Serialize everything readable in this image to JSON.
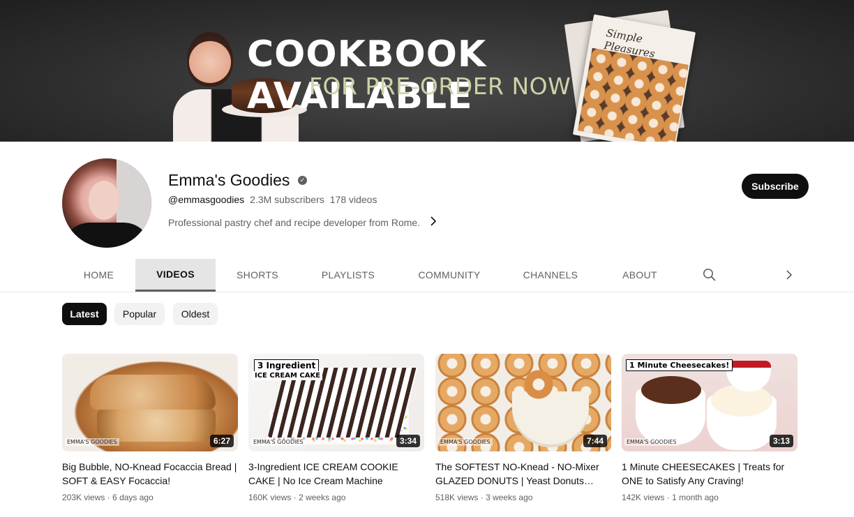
{
  "banner": {
    "title": "COOKBOOK AVAILABLE",
    "subtitle": "FOR PRE-ORDER NOW",
    "book_title": "Simple Pleasures"
  },
  "channel": {
    "name": "Emma's Goodies",
    "handle": "@emmasgoodies",
    "subscribers": "2.3M subscribers",
    "videos": "178 videos",
    "description": "Professional pastry chef and recipe developer from Rome.",
    "subscribe_label": "Subscribe"
  },
  "tabs": [
    {
      "label": "HOME"
    },
    {
      "label": "VIDEOS",
      "active": true
    },
    {
      "label": "SHORTS"
    },
    {
      "label": "PLAYLISTS"
    },
    {
      "label": "COMMUNITY"
    },
    {
      "label": "CHANNELS"
    },
    {
      "label": "ABOUT"
    }
  ],
  "chips": [
    {
      "label": "Latest",
      "active": true
    },
    {
      "label": "Popular"
    },
    {
      "label": "Oldest"
    }
  ],
  "videos": [
    {
      "title": "Big Bubble, NO-Knead Focaccia Bread | SOFT & EASY Focaccia!",
      "views": "203K views",
      "age": "6 days ago",
      "duration": "6:27",
      "watermark": "EMMA'S GOODIES"
    },
    {
      "title": "3-Ingredient ICE CREAM COOKIE CAKE | No Ice Cream Machine",
      "views": "160K views",
      "age": "2 weeks ago",
      "duration": "3:34",
      "overlay_line1": "3 Ingredient",
      "overlay_line2": "ICE CREAM CAKE",
      "watermark": "EMMA'S GOODIES"
    },
    {
      "title": "The SOFTEST NO-Knead - NO-Mixer GLAZED DONUTS | Yeast Donuts…",
      "views": "518K views",
      "age": "3 weeks ago",
      "duration": "7:44",
      "watermark": "EMMA'S GOODIES"
    },
    {
      "title": "1 Minute CHEESECAKES | Treats for ONE to Satisfy Any Craving!",
      "views": "142K views",
      "age": "1 month ago",
      "duration": "3:13",
      "overlay_line1": "1 Minute Cheesecakes!",
      "watermark": "EMMA'S GOODIES"
    }
  ],
  "meta_separator": "·",
  "icons": {
    "verified": "check-circle-icon",
    "search": "search-icon",
    "more_tabs": "chevron-right-icon",
    "description_more": "chevron-right-icon"
  },
  "colors": {
    "primary_text": "#0f0f0f",
    "secondary_text": "#606060",
    "active_tab_bg": "#e5e5e5",
    "chip_bg": "#f2f2f2",
    "subscribe_bg": "#0f0f0f"
  }
}
